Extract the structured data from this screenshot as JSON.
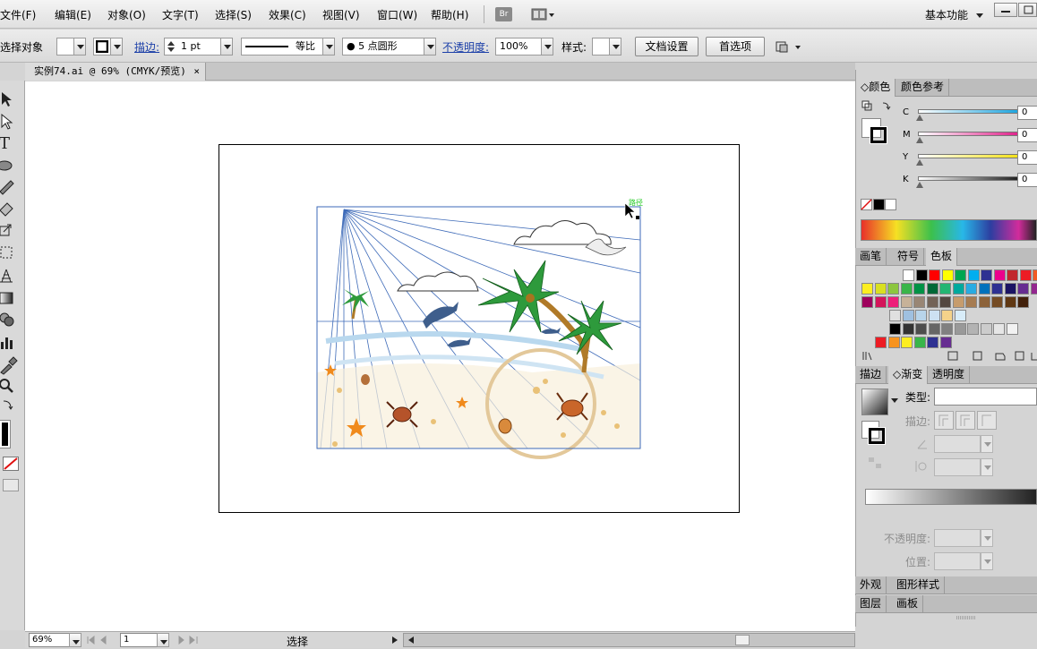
{
  "menubar": {
    "items": [
      {
        "label": "文件(F)"
      },
      {
        "label": "编辑(E)"
      },
      {
        "label": "对象(O)"
      },
      {
        "label": "文字(T)"
      },
      {
        "label": "选择(S)"
      },
      {
        "label": "效果(C)"
      },
      {
        "label": "视图(V)"
      },
      {
        "label": "窗口(W)"
      },
      {
        "label": "帮助(H)"
      }
    ],
    "br_badge": "Br",
    "workspace": "基本功能"
  },
  "controlbar": {
    "selection_label": "未选择对象",
    "stroke_link": "描边",
    "stroke_weight": "1 pt",
    "stroke_profile": "等比",
    "brush": "5 点圆形",
    "opacity_link": "不透明度",
    "opacity_value": "100%",
    "style_label": "样式:",
    "doc_setup_button": "文档设置",
    "prefs_button": "首选项"
  },
  "document": {
    "tab_title": "实例74.ai @ 69% (CMYK/预览)",
    "close": "×",
    "path_hint": "路径"
  },
  "statusbar": {
    "zoom": "69%",
    "page": "1",
    "mode": "选择"
  },
  "color_panel": {
    "tabs": [
      "颜色",
      "颜色参考"
    ],
    "channels": [
      {
        "label": "C",
        "value": "0",
        "color": "#1fa6e0"
      },
      {
        "label": "M",
        "value": "0",
        "color": "#e0248c"
      },
      {
        "label": "Y",
        "value": "0",
        "color": "#f3e21a"
      },
      {
        "label": "K",
        "value": "0",
        "color": "#222222"
      }
    ]
  },
  "swatch_panel": {
    "tabs": [
      "画笔",
      "符号",
      "色板"
    ],
    "rows": [
      [
        "#ffffff",
        "#000000",
        "#ff0000",
        "#ffff00",
        "#00a650",
        "#00aeef",
        "#2e3192",
        "#ec008c",
        "#c1272d",
        "#ed1c24",
        "#f15a24",
        "#f7931e"
      ],
      [
        "#fcee21",
        "#d9e021",
        "#8cc63f",
        "#39b54a",
        "#009245",
        "#006837",
        "#22b573",
        "#00a99d",
        "#29abe2",
        "#0071bc",
        "#2e3192",
        "#1b1464",
        "#662d91",
        "#93278f"
      ],
      [
        "#9e005d",
        "#d4145a",
        "#ed1e79",
        "#c7b299",
        "#998675",
        "#736357",
        "#534741",
        "#c69c6d",
        "#a67c52",
        "#8c6239",
        "#754c24",
        "#603813",
        "#42210b"
      ],
      [
        "#e0e0e0",
        "#9fc0e0",
        "#b8d4ea",
        "#cde1f2",
        "#f4d28a",
        "#d8ecf8"
      ],
      [
        "#000000",
        "#333333",
        "#4d4d4d",
        "#666666",
        "#808080",
        "#999999",
        "#b3b3b3",
        "#cccccc",
        "#e6e6e6",
        "#f2f2f2"
      ],
      [
        "#ed1c24",
        "#f7931e",
        "#fcee21",
        "#39b54a",
        "#2e3192",
        "#662d91"
      ]
    ]
  },
  "gradient_panel": {
    "tabs": [
      "描边",
      "渐变",
      "透明度"
    ],
    "type_label": "类型:",
    "stroke_label": "描边:",
    "opacity_label": "不透明度:",
    "position_label": "位置:"
  },
  "bottom_panels": {
    "row1": [
      "外观",
      "图形样式"
    ],
    "row2": [
      "图层",
      "画板"
    ]
  }
}
